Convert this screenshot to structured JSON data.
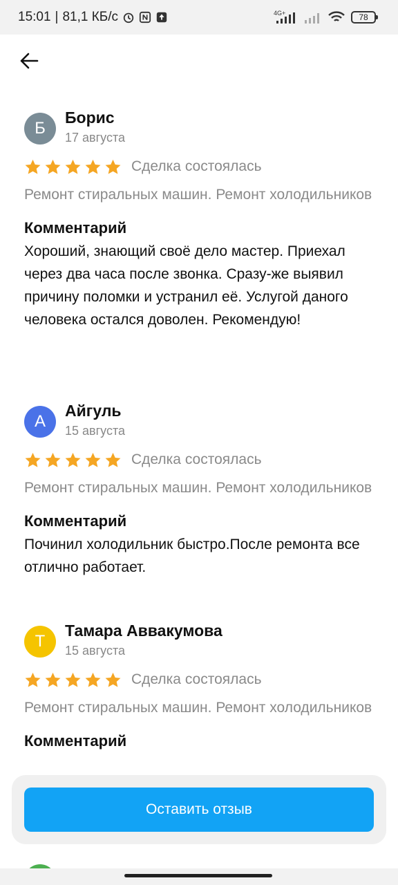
{
  "status_bar": {
    "time": "15:01",
    "speed": "81,1 КБ/с",
    "network": "4G+",
    "battery": "78"
  },
  "header": {
    "back_icon": "arrow-left-icon"
  },
  "reviews": [
    {
      "avatar_letter": "Б",
      "avatar_color": "#7a8c96",
      "name": "Борис",
      "date": "17 августа",
      "stars": 5,
      "deal_status": "Сделка состоялась",
      "service": "Ремонт стиральных машин. Ремонт холодильников",
      "comment_title": "Комментарий",
      "comment": "Хороший, знающий своё дело мастер. Приехал через два часа после звонка. Сразу-же выявил причину поломки и устранил её. Услугой даного человека остался доволен. Рекомендую!"
    },
    {
      "avatar_letter": "А",
      "avatar_color": "#4a72e8",
      "name": "Айгуль",
      "date": "15 августа",
      "stars": 5,
      "deal_status": "Сделка состоялась",
      "service": "Ремонт стиральных машин. Ремонт холодильников",
      "comment_title": "Комментарий",
      "comment": "Починил холодильник быстро.После ремонта все отлично работает."
    },
    {
      "avatar_letter": "Т",
      "avatar_color": "#f5c400",
      "name": "Тамара Аввакумова",
      "date": "15 августа",
      "stars": 5,
      "deal_status": "Сделка состоялась",
      "service": "Ремонт стиральных машин. Ремонт холодильников",
      "comment_title": "Комментарий"
    }
  ],
  "action": {
    "leave_review_label": "Оставить отзыв"
  },
  "colors": {
    "accent": "#12a3f5",
    "star": "#f5a623"
  }
}
